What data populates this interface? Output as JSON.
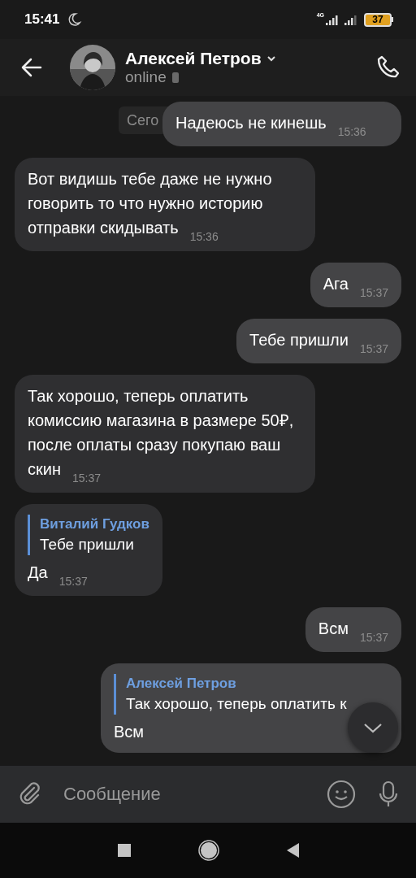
{
  "status_bar": {
    "time": "15:41",
    "network": "4G",
    "battery": "37"
  },
  "header": {
    "name": "Алексей Петров",
    "status": "online"
  },
  "date_chip": "Сего",
  "messages": [
    {
      "kind": "text",
      "outgoing": true,
      "text": "Надеюсь не кинешь",
      "time": "15:36"
    },
    {
      "kind": "text",
      "outgoing": false,
      "text": "Вот видишь тебе даже не нужно говорить то что нужно историю отправки скидывать",
      "time": "15:36"
    },
    {
      "kind": "text",
      "outgoing": true,
      "text": "Ага",
      "time": "15:37"
    },
    {
      "kind": "text",
      "outgoing": true,
      "text": "Тебе пришли",
      "time": "15:37"
    },
    {
      "kind": "text",
      "outgoing": false,
      "text": "Так хорошо, теперь оплатить комиссию магазина в размере 50₽, после оплаты сразу покупаю ваш скин",
      "time": "15:37"
    },
    {
      "kind": "reply",
      "outgoing": false,
      "quote_author": "Виталий Гудков",
      "quote_text": "Тебе пришли",
      "text": "Да",
      "time": "15:37"
    },
    {
      "kind": "text",
      "outgoing": true,
      "text": "Всм",
      "time": "15:37"
    },
    {
      "kind": "reply",
      "outgoing": true,
      "quote_author": "Алексей Петров",
      "quote_text": "Так хорошо, теперь оплатить к",
      "text": "Всм"
    }
  ],
  "composer": {
    "placeholder": "Сообщение"
  }
}
